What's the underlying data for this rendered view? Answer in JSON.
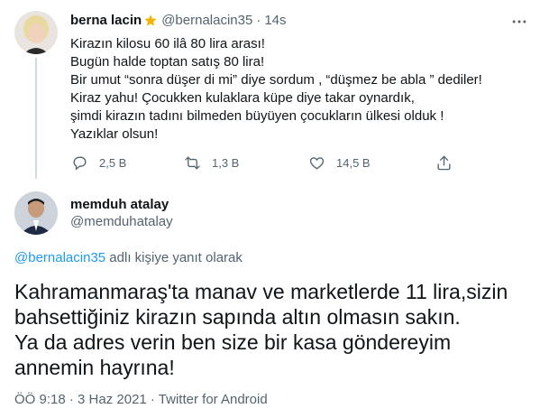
{
  "tweet1": {
    "name": "berna lacin",
    "handle": "@bernalacin35",
    "separator": "·",
    "time": "14s",
    "lines": [
      "Kirazın kilosu 60 ilâ 80 lira arası!",
      "Bugün halde toptan satış 80 lira!",
      "Bir umut “sonra düşer di mi” diye sordum , “düşmez be abla ” dediler!",
      "Kiraz yahu! Çocukken kulaklara küpe diye takar oynardık,",
      "şimdi kirazın tadını bilmeden büyüyen çocukların ülkesi olduk !",
      "Yazıklar olsun!"
    ],
    "replies": "2,5 B",
    "retweets": "1,3 B",
    "likes": "14,5 B"
  },
  "tweet2": {
    "name": "memduh atalay",
    "handle": "@memduhatalay",
    "reply_to_handle": "@bernalacin35",
    "reply_to_suffix": " adlı kişiye yanıt olarak",
    "lines": [
      "Kahramanmaraş'ta manav ve marketlerde 11 lira,sizin",
      "bahsettiğiniz kirazın sapında altın olmasın sakın.",
      "Ya da adres verin ben size bir kasa göndereyim",
      "annemin hayrına!"
    ],
    "meta": "ÖÖ 9:18 · 3 Haz 2021 · Twitter for Android"
  },
  "colors": {
    "link": "#1d9bf0",
    "muted": "#536471",
    "badge": "#f4b400"
  }
}
